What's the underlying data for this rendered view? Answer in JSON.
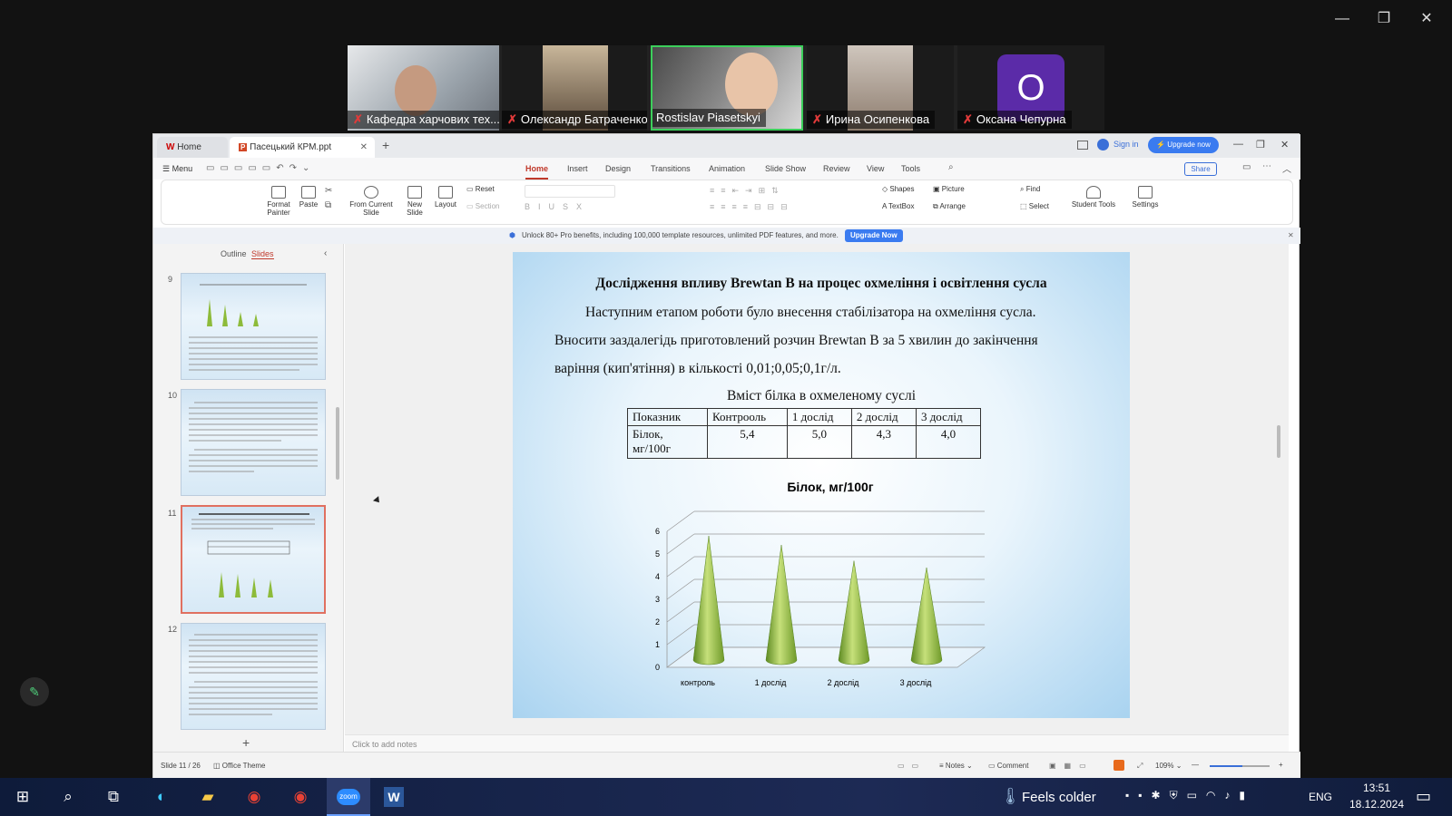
{
  "zoom": {
    "participants": [
      {
        "name": "Кафедра харчових тех...",
        "muted": true
      },
      {
        "name": "Олександр Батраченко",
        "muted": true
      },
      {
        "name": "Rostislav Piasetskyi",
        "muted": false,
        "speaking": true
      },
      {
        "name": "Ирина Осипенкова",
        "muted": true
      },
      {
        "name": "Оксана Чепурна",
        "muted": true,
        "avatar_letter": "О",
        "avatar_color": "#5b2ba8"
      }
    ]
  },
  "wps": {
    "tabs": {
      "home": "Home",
      "doc": "Пасецький КРМ.ppt"
    },
    "sign_in": "Sign in",
    "upgrade": "Upgrade now",
    "menu_label": "Menu",
    "menu_tabs": [
      "Home",
      "Insert",
      "Design",
      "Transitions",
      "Animation",
      "Slide Show",
      "Review",
      "View",
      "Tools"
    ],
    "share": "Share",
    "ribbon": {
      "format_painter": "Format Painter",
      "paste": "Paste",
      "from_current": "From Current Slide",
      "new_slide": "New Slide",
      "layout": "Layout",
      "reset": "Reset",
      "section": "Section",
      "shapes": "Shapes",
      "picture": "Picture",
      "textbox": "TextBox",
      "arrange": "Arrange",
      "find": "Find",
      "select": "Select",
      "student_tools": "Student Tools",
      "settings": "Settings"
    },
    "banner": {
      "text": "Unlock 80+ Pro benefits, including 100,000 template resources, unlimited PDF features, and more.",
      "button": "Upgrade Now"
    },
    "pane_tabs": {
      "outline": "Outline",
      "slides": "Slides"
    },
    "slide_numbers": [
      "9",
      "10",
      "11",
      "12"
    ],
    "notes_placeholder": "Click to add notes",
    "status": {
      "slide": "Slide 11 / 26",
      "theme": "Office Theme",
      "notes": "Notes",
      "comment": "Comment",
      "zoom": "109%"
    }
  },
  "slide": {
    "title": "Дослідження впливу  Brewtan B на процес охмеління і освітлення сусла",
    "para_line1": "Наступним етапом роботи  було внесення стабілізатора на охмеління сусла.",
    "para_line2": "Вносити заздалегідь приготовлений розчин Brewtan B за 5 хвилин до закінчення",
    "para_line3": "варіння (кип'ятіння) в кількості 0,01;0,05;0,1г/л.",
    "table_title": "Вміст білка в охмеленому суслі",
    "table": {
      "headers": [
        "Показник",
        "Контрооль",
        "1 дослід",
        "2 дослід",
        "3 дослід"
      ],
      "row_label": "Білок, мг/100г",
      "row_values": [
        "5,4",
        "5,0",
        "4,3",
        "4,0"
      ]
    }
  },
  "chart_data": {
    "type": "bar",
    "style": "3d-cone",
    "title": "Білок, мг/100г",
    "categories": [
      "контроль",
      "1 дослід",
      "2 дослід",
      "3 дослід"
    ],
    "values": [
      5.4,
      5.0,
      4.3,
      4.0
    ],
    "ylim": [
      0,
      6
    ],
    "yticks": [
      "0",
      "1",
      "2",
      "3",
      "4",
      "5",
      "6"
    ],
    "color": "#8dbb3a",
    "grid": true
  },
  "taskbar": {
    "weather": "Feels colder",
    "lang": "ENG",
    "time": "13:51",
    "date": "18.12.2024",
    "app_zoom": "zoom"
  }
}
